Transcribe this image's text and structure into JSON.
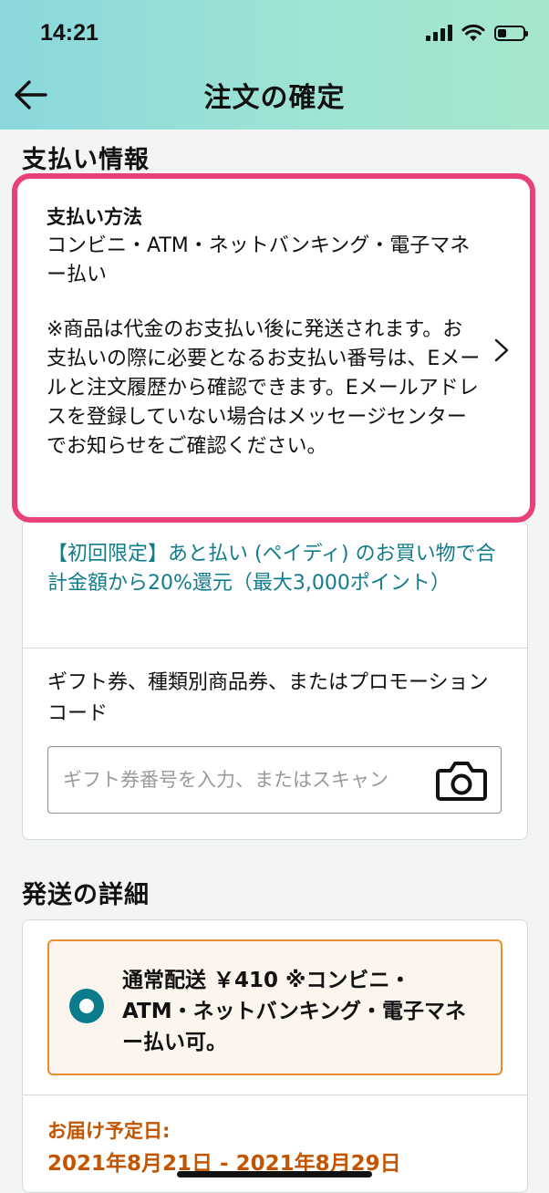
{
  "status_bar": {
    "time": "14:21"
  },
  "nav": {
    "title": "注文の確定"
  },
  "payment": {
    "section_title": "支払い情報",
    "method_label": "支払い方法",
    "method_value": "コンビニ・ATM・ネットバンキング・電子マネー払い",
    "note": "※商品は代金のお支払い後に発送されます。お支払いの際に必要となるお支払い番号は、Eメールと注文履歴から確認できます。Eメールアドレスを登録していない場合はメッセージセンターでお知らせをご確認ください。",
    "promo_link": "【初回限定】あと払い (ペイディ) のお買い物で合計金額から20%還元（最大3,000ポイント）",
    "gift_label": "ギフト券、種類別商品券、またはプロモーションコード",
    "gift_placeholder": "ギフト券番号を入力、またはスキャン"
  },
  "shipping": {
    "section_title": "発送の詳細",
    "option_text": "通常配送 ￥410 ※コンビニ・ATM・ネットバンキング・電子マネー払い可。",
    "option_selected": true,
    "eta_label": "お届け予定日:",
    "eta_value": "2021年8月21日 - 2021年8月29日"
  },
  "colors": {
    "header_gradient": [
      "#8ad8dc",
      "#a6e6cc"
    ],
    "highlight_border": "#e8407a",
    "link": "#127c8c",
    "radio": "#0a7c8c",
    "shipping_border": "#e98d2f",
    "shipping_bg": "#fcf5ee",
    "eta": "#c45500"
  },
  "icons": {
    "back": "arrow-left-icon",
    "chevron": "chevron-right-icon",
    "camera": "camera-icon",
    "signal": "cellular-signal-icon",
    "wifi": "wifi-icon",
    "battery": "battery-icon"
  }
}
